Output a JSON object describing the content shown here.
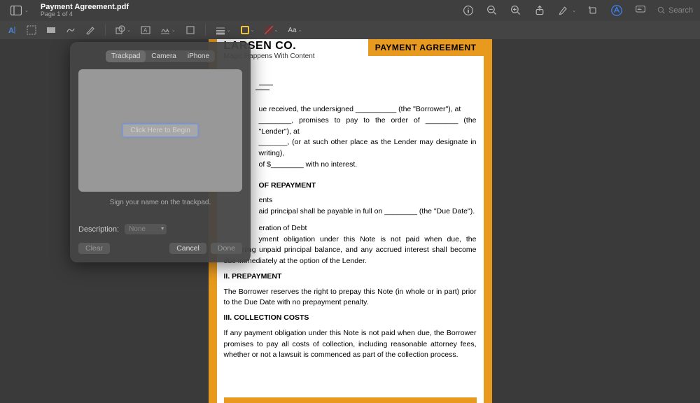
{
  "header": {
    "file_title": "Payment Agreement.pdf",
    "page_info": "Page 1 of 4",
    "search_placeholder": "Search"
  },
  "second_toolbar": {
    "text_style_label": "Aa"
  },
  "signature": {
    "tabs": [
      "Trackpad",
      "Camera",
      "iPhone"
    ],
    "begin_button": "Click Here to Begin",
    "hint": "Sign your name on the trackpad.",
    "description_label": "Description:",
    "description_value": "None",
    "clear": "Clear",
    "cancel": "Cancel",
    "done": "Done"
  },
  "document": {
    "company_name": "LARSEN CO.",
    "company_tag": "Magic Happens With Content",
    "title_badge": "PAYMENT AGREEMENT",
    "p1_a": "ue received, the undersigned __________ (the \"Borrower\"), at",
    "p1_b": "________, promises to pay to the order of ________ (the \"Lender\"), at",
    "p1_c": "_______, (or at such other place as the Lender may designate in writing),",
    "p1_d": "of $________ with no interest.",
    "s1_h": "OF REPAYMENT",
    "s1_a": "ents",
    "s1_b": "aid principal shall be payable in full on ________ (the \"Due Date\").",
    "s1_c": "eration of Debt",
    "s1_d": "yment obligation under this Note is not paid when due, the remaining unpaid principal balance, and any accrued interest shall become due immediately at the option of the Lender.",
    "s2_h": "II. PREPAYMENT",
    "s2_a": "The Borrower reserves the right to prepay this Note (in whole or in part) prior to the Due Date with no prepayment penalty.",
    "s3_h": "III. COLLECTION COSTS",
    "s3_a": "If any payment obligation under this Note is not paid when due, the Borrower promises to pay all costs of collection, including reasonable attorney fees, whether or not a lawsuit is commenced as part of the collection process."
  }
}
